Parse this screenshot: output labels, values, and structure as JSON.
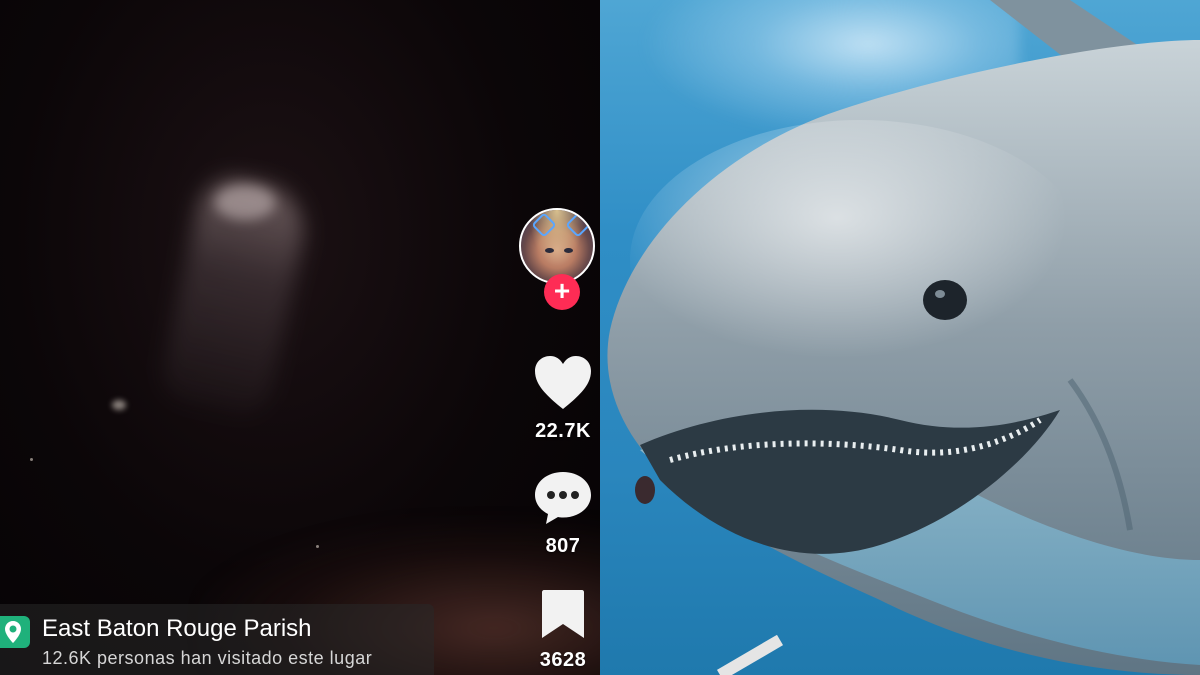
{
  "video": {
    "creator_avatar": "creator-avatar",
    "follow_symbol": "+",
    "likes": "22.7K",
    "comments": "807",
    "saves": "3628",
    "icons": {
      "like": "heart-icon",
      "comment": "chat-bubble-icon",
      "save": "bookmark-icon",
      "location": "location-pin-icon"
    },
    "location": {
      "name": "East Baton Rouge Parish",
      "visits": "12.6K personas han visitado este lugar"
    }
  },
  "colors": {
    "follow": "#fe2c55",
    "pin": "#1fb17b",
    "water": "#2f8ec6"
  }
}
